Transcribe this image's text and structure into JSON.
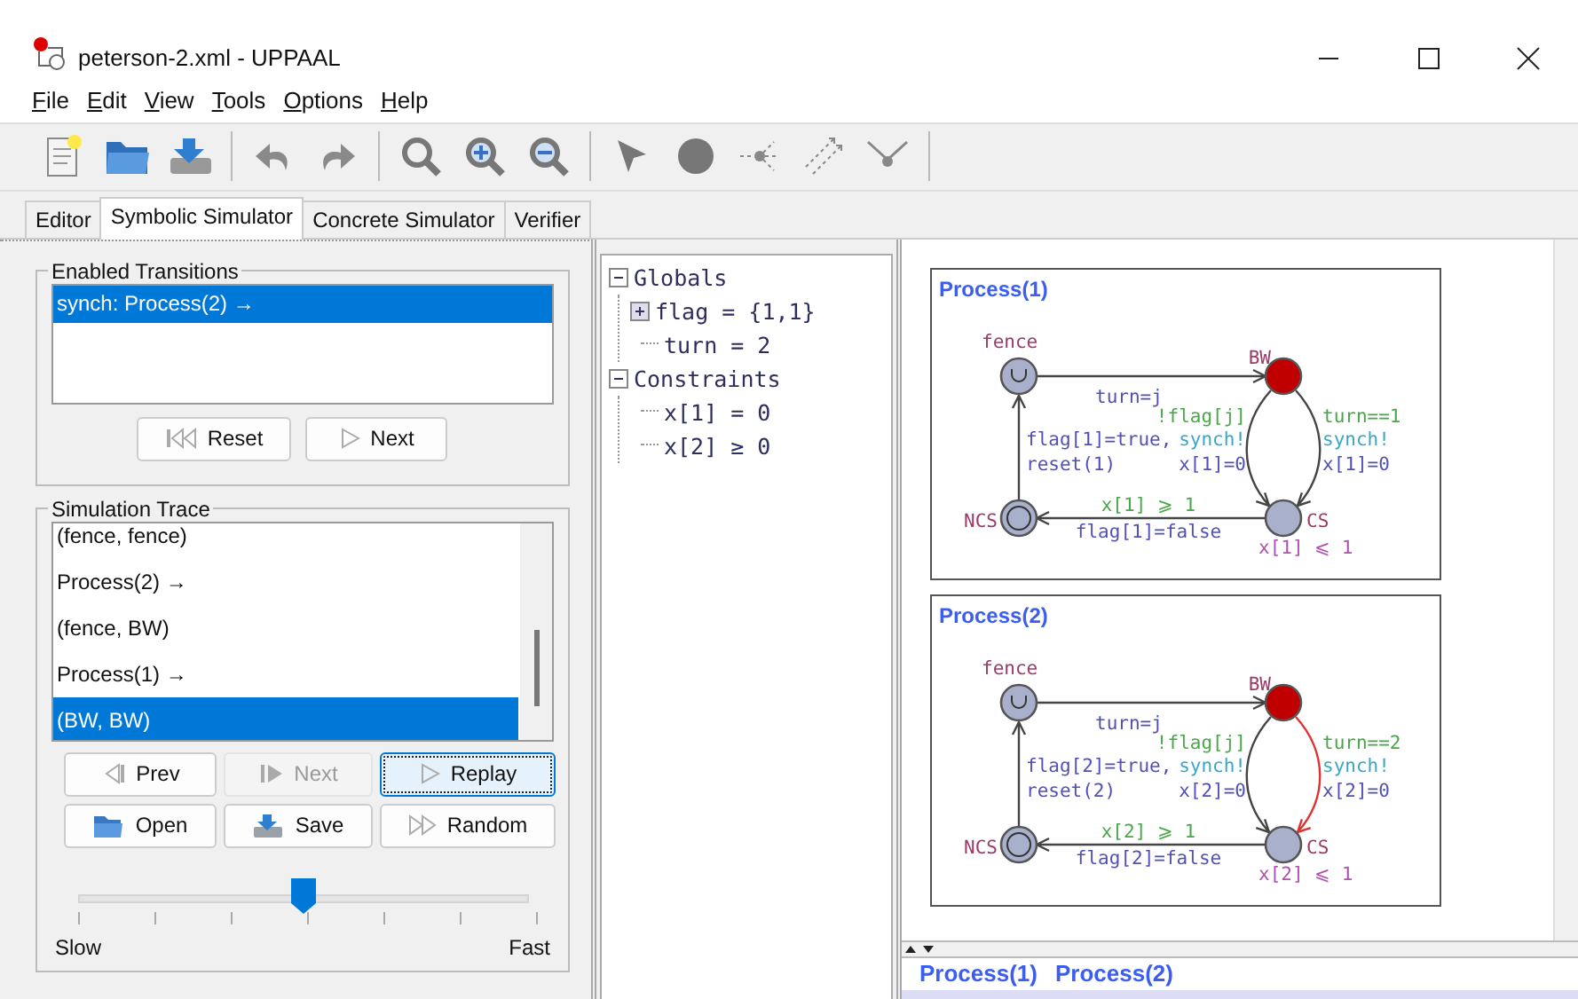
{
  "window": {
    "title": "peterson-2.xml - UPPAAL"
  },
  "menu": [
    "File",
    "Edit",
    "View",
    "Tools",
    "Options",
    "Help"
  ],
  "tabs": [
    {
      "label": "Editor",
      "selected": false
    },
    {
      "label": "Symbolic Simulator",
      "selected": true
    },
    {
      "label": "Concrete Simulator",
      "selected": false
    },
    {
      "label": "Verifier",
      "selected": false
    }
  ],
  "enabled_transitions": {
    "title": "Enabled Transitions",
    "items": [
      {
        "label": "synch: Process(2) →",
        "selected": true
      }
    ],
    "buttons": [
      {
        "label": "Reset",
        "kind": "reset",
        "disabled": false,
        "focused": false
      },
      {
        "label": "Next",
        "kind": "next",
        "disabled": false,
        "focused": false
      }
    ]
  },
  "simulation_trace": {
    "title": "Simulation Trace",
    "items": [
      {
        "label": "(fence, fence)",
        "selected": false
      },
      {
        "label": "Process(2) →",
        "selected": false
      },
      {
        "label": "(fence, BW)",
        "selected": false
      },
      {
        "label": "Process(1) →",
        "selected": false
      },
      {
        "label": "(BW, BW)",
        "selected": true
      }
    ],
    "buttons": [
      {
        "label": "Prev",
        "kind": "prev",
        "disabled": false,
        "focused": false
      },
      {
        "label": "Next",
        "kind": "next",
        "disabled": true,
        "focused": false
      },
      {
        "label": "Replay",
        "kind": "replay",
        "disabled": false,
        "focused": true
      },
      {
        "label": "Open",
        "kind": "open",
        "disabled": false,
        "focused": false
      },
      {
        "label": "Save",
        "kind": "save",
        "disabled": false,
        "focused": false
      },
      {
        "label": "Random",
        "kind": "random",
        "disabled": false,
        "focused": false
      }
    ],
    "speed": {
      "level": 0.5,
      "min_label": "Slow",
      "max_label": "Fast"
    }
  },
  "variables": [
    {
      "label": "Globals",
      "expanded": true,
      "children": [
        {
          "label": "flag = {1,1}",
          "expanded": false
        },
        {
          "label": "turn = 2"
        }
      ]
    },
    {
      "label": "Constraints",
      "expanded": true,
      "children": [
        {
          "label": "x[1] = 0"
        },
        {
          "label": "x[2] ≥ 0"
        }
      ]
    }
  ],
  "processes": [
    {
      "title": "Process(1)",
      "locations": [
        {
          "name": "fence",
          "kind": "urgent",
          "current": false
        },
        {
          "name": "BW",
          "kind": "normal",
          "current": true
        },
        {
          "name": "NCS",
          "kind": "initial",
          "current": false
        },
        {
          "name": "CS",
          "kind": "normal",
          "current": false,
          "invariant": "x[1] ⩽ 1"
        }
      ],
      "edges": [
        {
          "highlighted": false,
          "labels": [
            {
              "kind": "update",
              "text": "turn=j"
            }
          ]
        },
        {
          "highlighted": false,
          "labels": [
            {
              "kind": "guard",
              "text": "!flag[j]"
            },
            {
              "kind": "sync",
              "text": "synch!"
            },
            {
              "kind": "update",
              "text": "x[1]=0"
            }
          ]
        },
        {
          "highlighted": false,
          "labels": [
            {
              "kind": "guard",
              "text": "turn==1"
            },
            {
              "kind": "sync",
              "text": "synch!"
            },
            {
              "kind": "update",
              "text": "x[1]=0"
            }
          ]
        },
        {
          "highlighted": false,
          "labels": [
            {
              "kind": "guard",
              "text": "x[1] ⩾ 1"
            },
            {
              "kind": "update",
              "text": "flag[1]=false"
            }
          ]
        },
        {
          "highlighted": false,
          "labels": [
            {
              "kind": "update",
              "text": "flag[1]=true,"
            },
            {
              "kind": "update",
              "text": "reset(1)"
            }
          ]
        }
      ]
    },
    {
      "title": "Process(2)",
      "locations": [
        {
          "name": "fence",
          "kind": "urgent",
          "current": false
        },
        {
          "name": "BW",
          "kind": "normal",
          "current": true
        },
        {
          "name": "NCS",
          "kind": "initial",
          "current": false
        },
        {
          "name": "CS",
          "kind": "normal",
          "current": false,
          "invariant": "x[2] ⩽ 1"
        }
      ],
      "edges": [
        {
          "highlighted": false,
          "labels": [
            {
              "kind": "update",
              "text": "turn=j"
            }
          ]
        },
        {
          "highlighted": false,
          "labels": [
            {
              "kind": "guard",
              "text": "!flag[j]"
            },
            {
              "kind": "sync",
              "text": "synch!"
            },
            {
              "kind": "update",
              "text": "x[2]=0"
            }
          ]
        },
        {
          "highlighted": true,
          "labels": [
            {
              "kind": "guard",
              "text": "turn==2"
            },
            {
              "kind": "sync",
              "text": "synch!"
            },
            {
              "kind": "update",
              "text": "x[2]=0"
            }
          ]
        },
        {
          "highlighted": false,
          "labels": [
            {
              "kind": "guard",
              "text": "x[2] ⩾ 1"
            },
            {
              "kind": "update",
              "text": "flag[2]=false"
            }
          ]
        },
        {
          "highlighted": false,
          "labels": [
            {
              "kind": "update",
              "text": "flag[2]=true,"
            },
            {
              "kind": "update",
              "text": "reset(2)"
            }
          ]
        }
      ]
    }
  ],
  "bottom_tabs": [
    "Process(1)",
    "Process(2)"
  ]
}
